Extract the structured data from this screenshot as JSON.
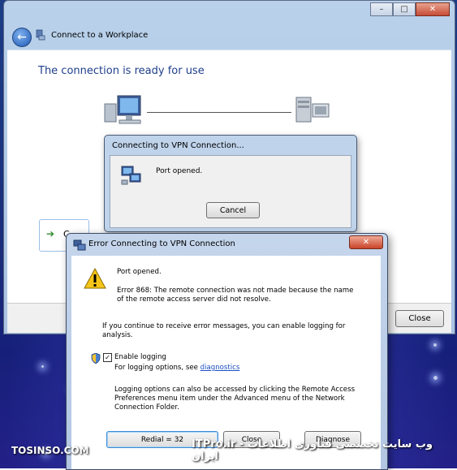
{
  "main_window": {
    "title": "Connect to a Workplace",
    "heading": "The connection is ready for use",
    "connect_option_label": "C",
    "close_label": "Close"
  },
  "connecting_dialog": {
    "title": "Connecting to VPN Connection...",
    "message": "Port opened.",
    "cancel_label": "Cancel"
  },
  "error_dialog": {
    "title": "Error Connecting to VPN Connection",
    "port_message": "Port opened.",
    "error_message": "Error 868: The remote connection was not made because the name of the remote access server did not resolve.",
    "logging_message": "If you continue to receive error messages, you can enable logging for analysis.",
    "enable_logging_label": "Enable logging",
    "enable_logging_checked": true,
    "logging_options_text": "For logging options, see",
    "diagnostics_link": "diagnostics",
    "info_text": "Logging options can also be accessed by clicking the Remote Access Preferences menu item under the Advanced menu of the Network Connection Folder.",
    "redial_label": "Redial = 32",
    "close_label": "Close",
    "diagnose_label": "Diagnose"
  },
  "watermark": {
    "left": "TOSINSO.COM",
    "right": "ITPro.ir - وب سایت تخصصی فناوری اطلاعات ایران"
  },
  "colors": {
    "heading": "#1e3e8c",
    "link": "#1a4fc4",
    "title_close": "#c64b36"
  }
}
